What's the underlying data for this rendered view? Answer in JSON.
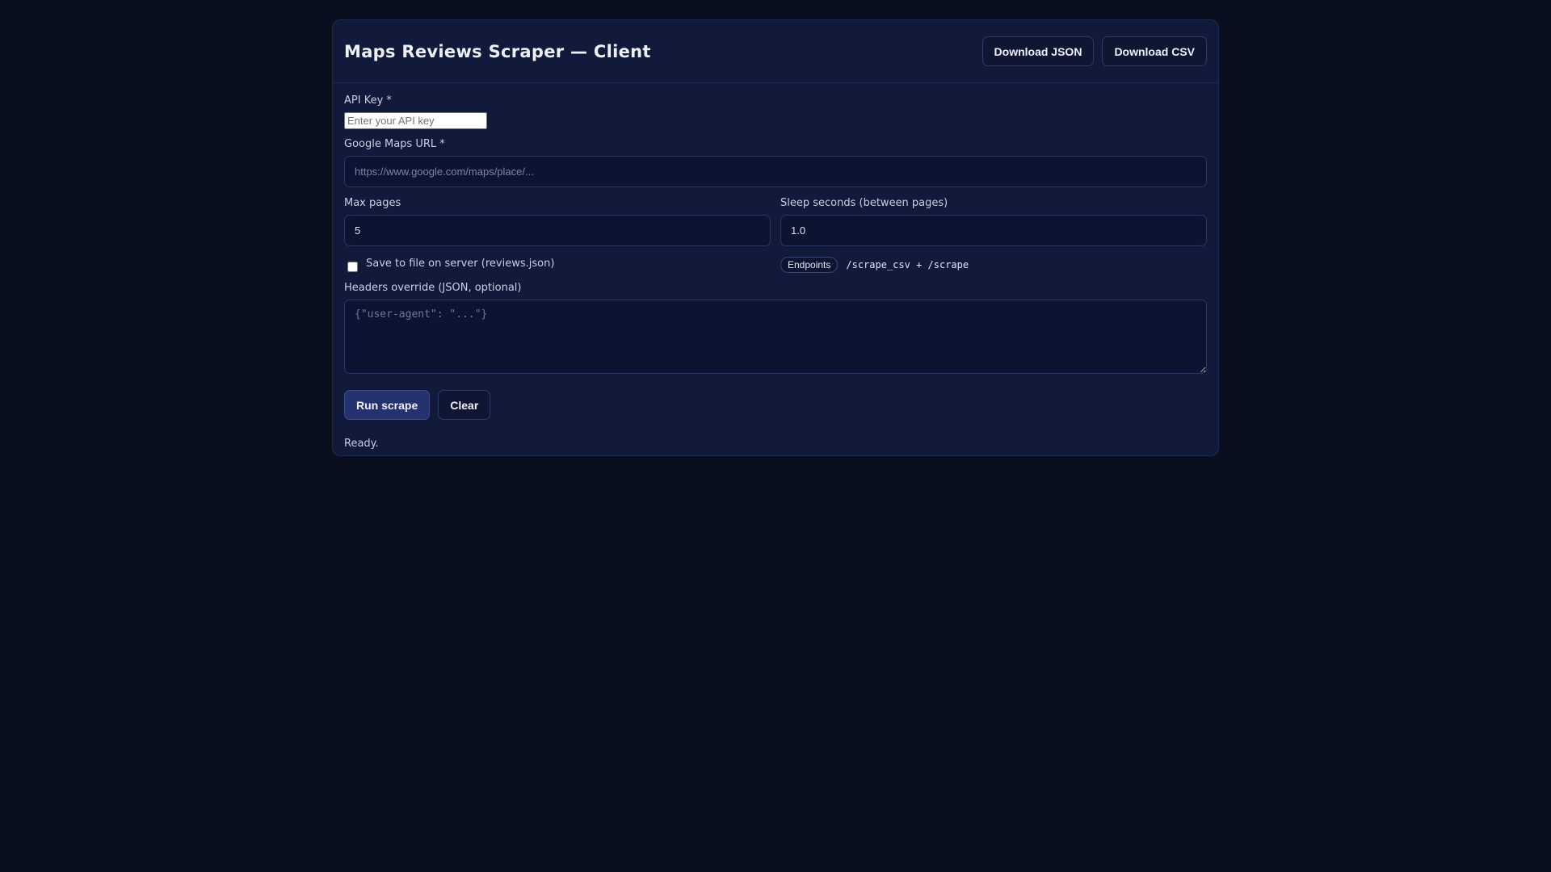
{
  "app": {
    "title": "Maps Reviews Scraper — Client"
  },
  "header": {
    "download_json_label": "Download JSON",
    "download_csv_label": "Download CSV"
  },
  "form": {
    "api_key": {
      "label": "API Key *",
      "placeholder": "Enter your API key",
      "value": ""
    },
    "maps_url": {
      "label": "Google Maps URL *",
      "placeholder": "https://www.google.com/maps/place/...",
      "value": ""
    },
    "max_pages": {
      "label": "Max pages",
      "value": "5"
    },
    "sleep_seconds": {
      "label": "Sleep seconds (between pages)",
      "value": "1.0"
    },
    "save_to_file": {
      "label": "Save to file on server (reviews.json)",
      "checked": false
    },
    "endpoints": {
      "badge": "Endpoints",
      "text": "/scrape_csv + /scrape"
    },
    "headers_override": {
      "label": "Headers override (JSON, optional)",
      "placeholder": "{\"user-agent\": \"...\"}",
      "value": ""
    }
  },
  "actions": {
    "run_label": "Run scrape",
    "clear_label": "Clear"
  },
  "status": {
    "text": "Ready."
  },
  "colors": {
    "background": "#0a0f1f",
    "panel": "#111a3a",
    "primary_button": "#243270"
  }
}
